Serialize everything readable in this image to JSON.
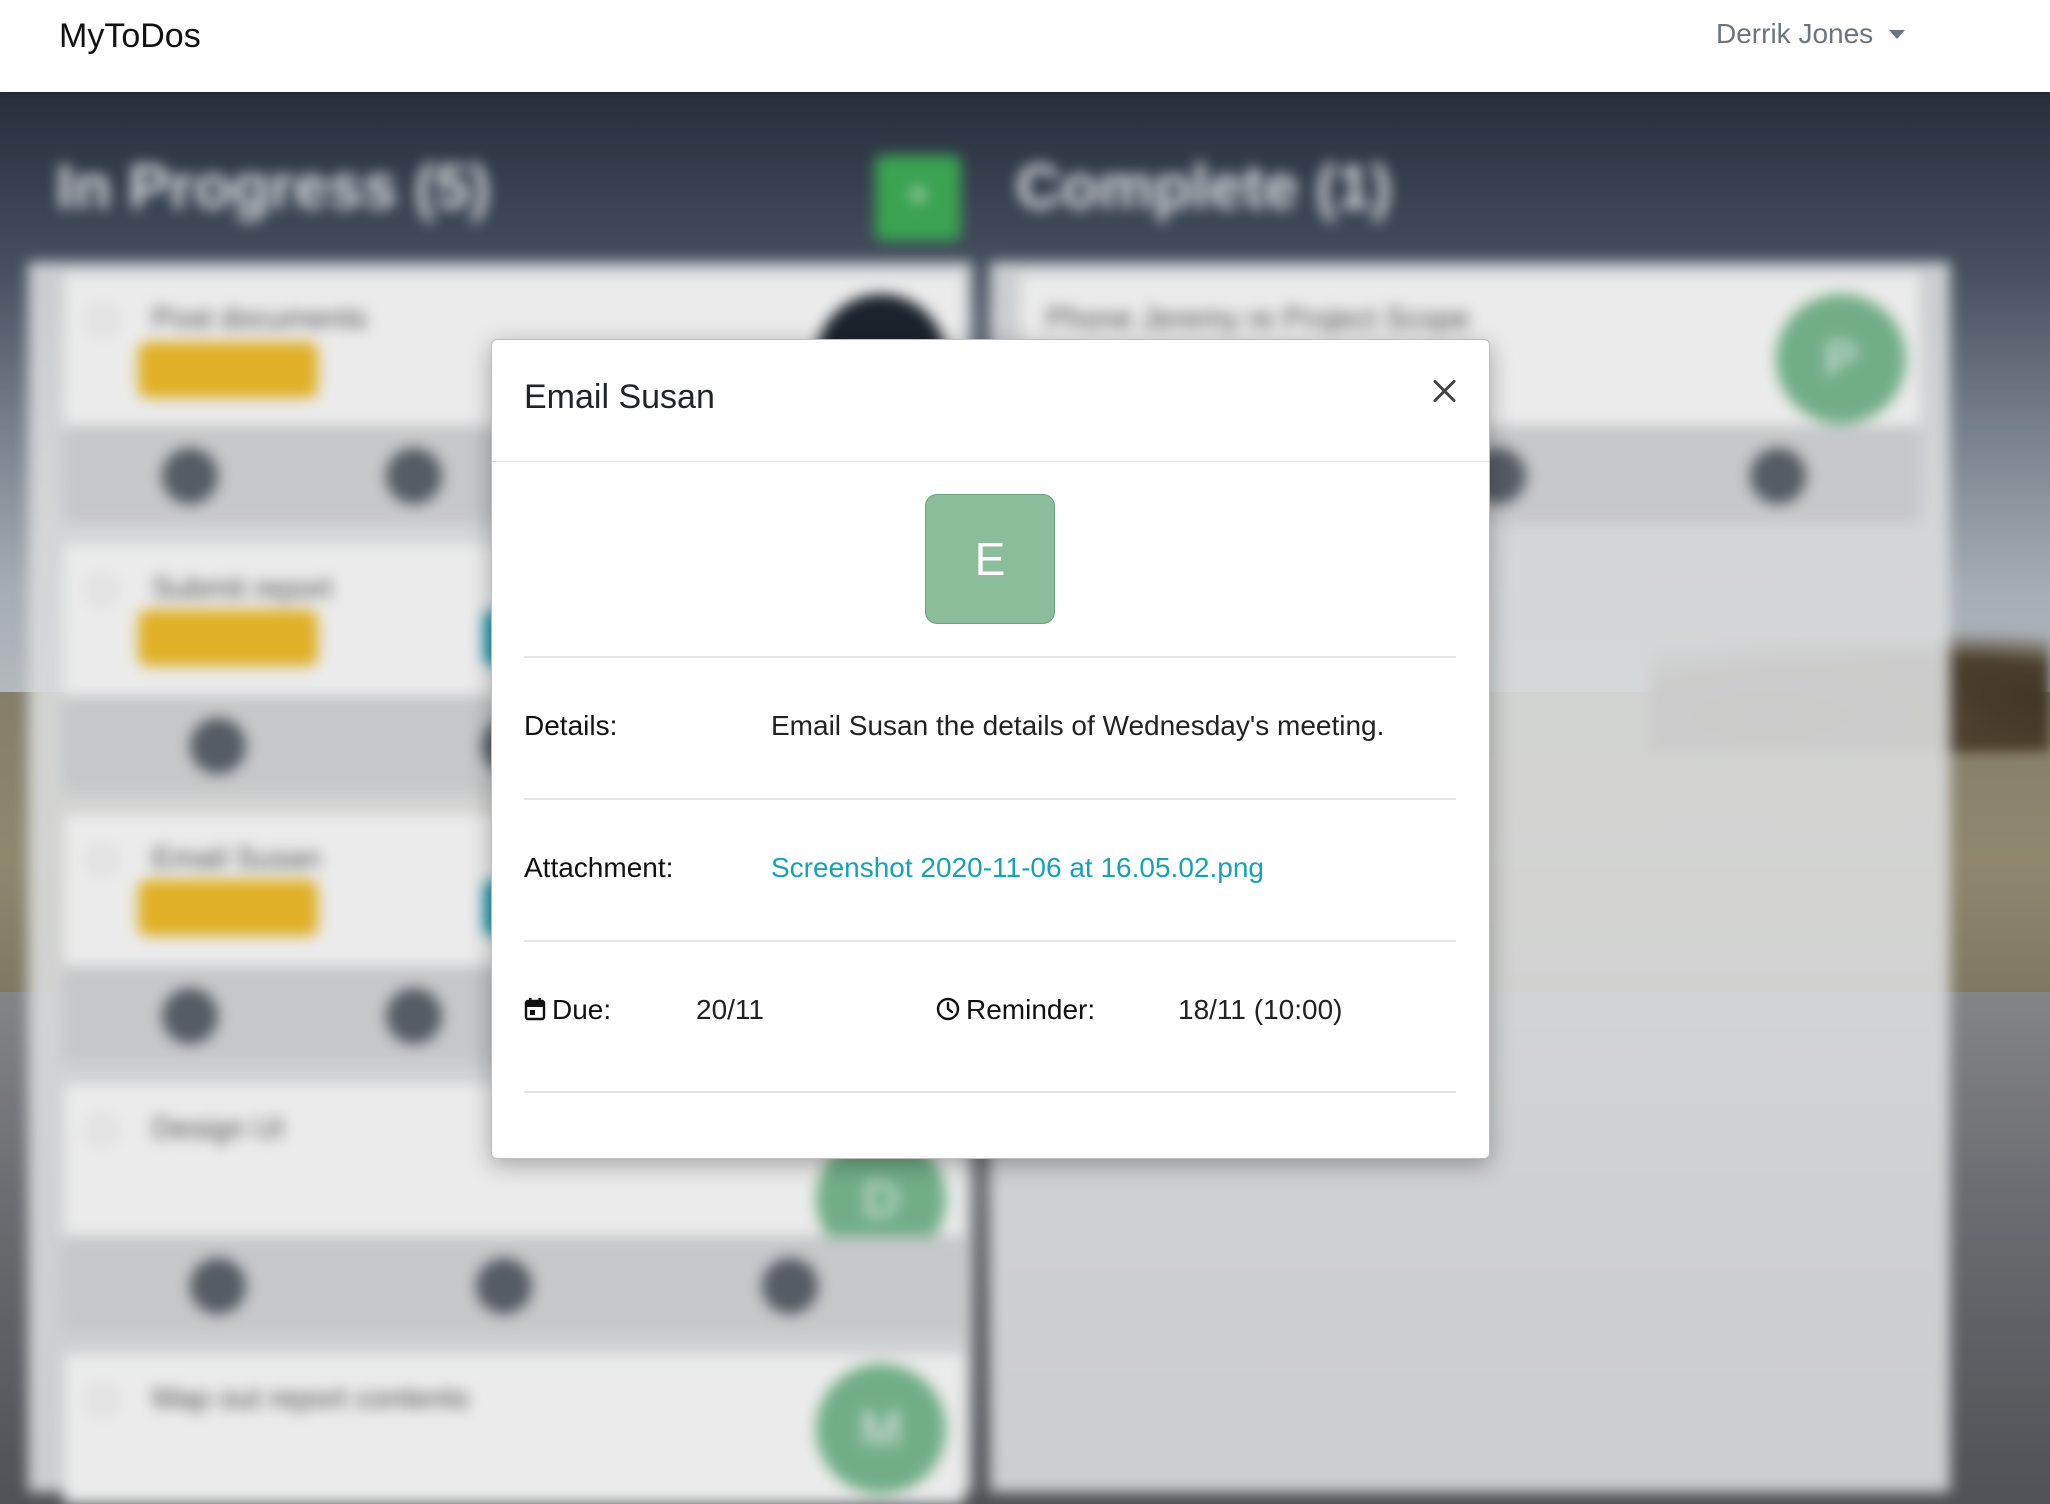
{
  "navbar": {
    "brand": "MyToDos",
    "user_name": "Derrik Jones"
  },
  "board": {
    "in_progress_title": "In Progress (5)",
    "complete_title": "Complete (1)",
    "in_progress_cards": [
      {
        "title": "Post documents",
        "avatar": ""
      },
      {
        "title": "Submit report",
        "avatar": ""
      },
      {
        "title": "Email Susan",
        "avatar": ""
      },
      {
        "title": "Design UI",
        "avatar": "D"
      },
      {
        "title": "Map out report contents",
        "avatar": "M"
      }
    ],
    "complete_cards": [
      {
        "title": "Phone Jeremy re Project Scope",
        "avatar": "P"
      }
    ],
    "colors": {
      "tag": "#f4c02a",
      "add": "#3fb15a",
      "avatar": "#7bbd93"
    }
  },
  "modal": {
    "title": "Email Susan",
    "avatar_letter": "E",
    "details_label": "Details:",
    "details_value": "Email Susan the details of Wednesday's meeting.",
    "attachment_label": "Attachment:",
    "attachment_value": "Screenshot 2020-11-06 at 16.05.02.png",
    "due_label": "Due:",
    "due_value": "20/11",
    "reminder_label": "Reminder:",
    "reminder_value": "18/11 (10:00)",
    "icons": {
      "due": "calendar-icon",
      "reminder": "clock-icon",
      "close": "close-icon"
    },
    "colors": {
      "avatar": "#8cbd9a",
      "link": "#17a2b8"
    }
  }
}
